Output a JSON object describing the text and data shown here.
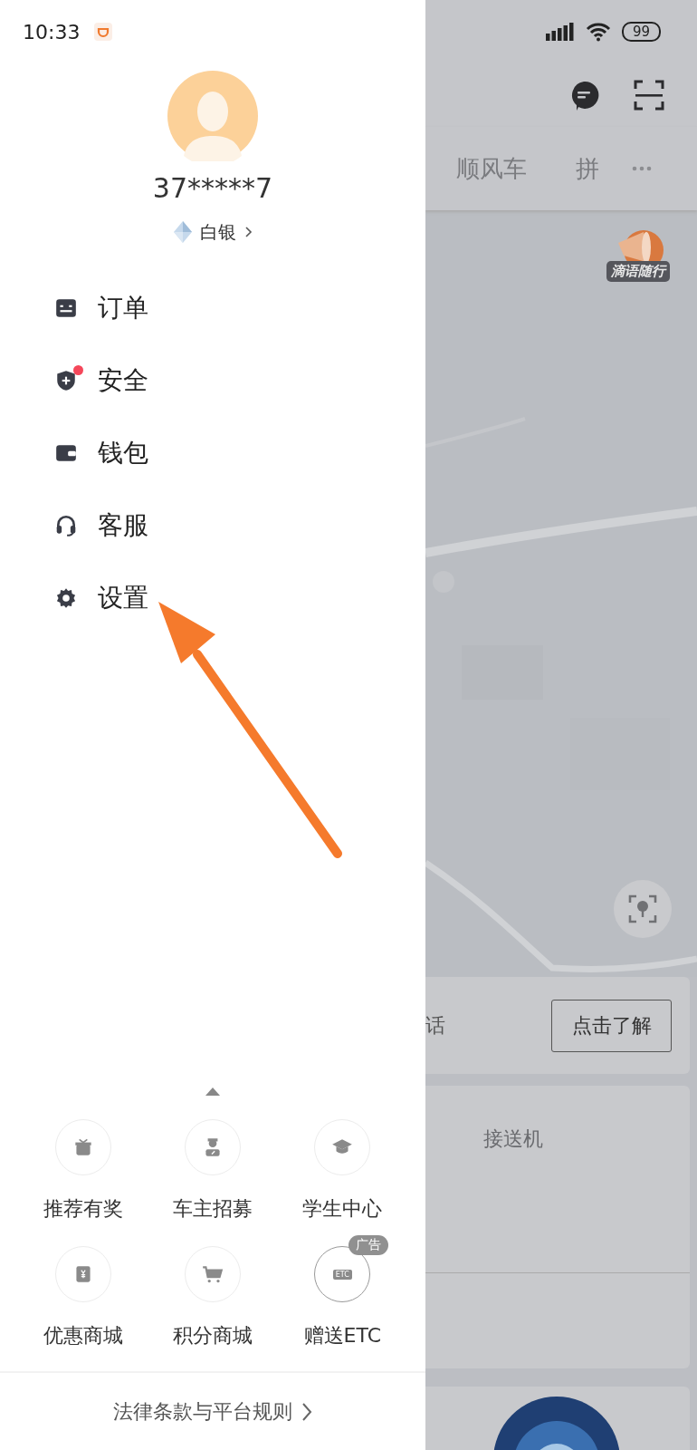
{
  "status_bar": {
    "time": "10:33",
    "battery": "99"
  },
  "profile": {
    "phone": "37*****7",
    "level": "白银"
  },
  "menu": [
    {
      "label": "订单",
      "alert": false
    },
    {
      "label": "安全",
      "alert": true
    },
    {
      "label": "钱包",
      "alert": false
    },
    {
      "label": "客服",
      "alert": false
    },
    {
      "label": "设置",
      "alert": false
    }
  ],
  "services": [
    {
      "label": "推荐有奖"
    },
    {
      "label": "车主招募"
    },
    {
      "label": "学生中心"
    },
    {
      "label": "优惠商城"
    },
    {
      "label": "积分商城"
    },
    {
      "label": "赠送ETC",
      "icon_text": "ETC",
      "badge": "广告"
    }
  ],
  "footer_link": "法律条款与平台规则",
  "background": {
    "tabs": [
      {
        "label": "顺风车"
      },
      {
        "label": "拼"
      }
    ],
    "map_badge": "滴语随行",
    "banner": {
      "text": "话",
      "button": "点击了解"
    },
    "card_label": "接送机"
  }
}
